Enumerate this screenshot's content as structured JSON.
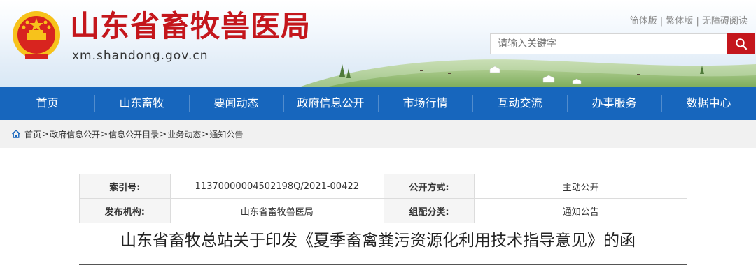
{
  "header": {
    "site_name": "山东省畜牧兽医局",
    "domain": "xm.shandong.gov.cn",
    "top_links": [
      "简体版",
      "繁体版",
      "无障碍阅读"
    ],
    "link_separator": "|",
    "search_placeholder": "请输入关键字",
    "search_icon": "search-icon"
  },
  "nav": {
    "items": [
      "首页",
      "山东畜牧",
      "要闻动态",
      "政府信息公开",
      "市场行情",
      "互动交流",
      "办事服务",
      "数据中心"
    ]
  },
  "breadcrumb": {
    "items": [
      "首页",
      "政府信息公开",
      "信息公开目录",
      "业务动态",
      "通知公告"
    ],
    "separator": ">"
  },
  "meta": {
    "index_label": "索引号:",
    "index_value": "11370000004502198Q/2021-00422",
    "open_method_label": "公开方式:",
    "open_method_value": "主动公开",
    "publisher_label": "发布机构:",
    "publisher_value": "山东省畜牧兽医局",
    "category_label": "组配分类:",
    "category_value": "通知公告"
  },
  "document": {
    "title": "山东省畜牧总站关于印发《夏季畜禽粪污资源化利用技术指导意见》的函"
  },
  "colors": {
    "brand_red": "#c4161c",
    "nav_blue": "#1766bd",
    "crumb_bg": "#f1f1f1"
  }
}
